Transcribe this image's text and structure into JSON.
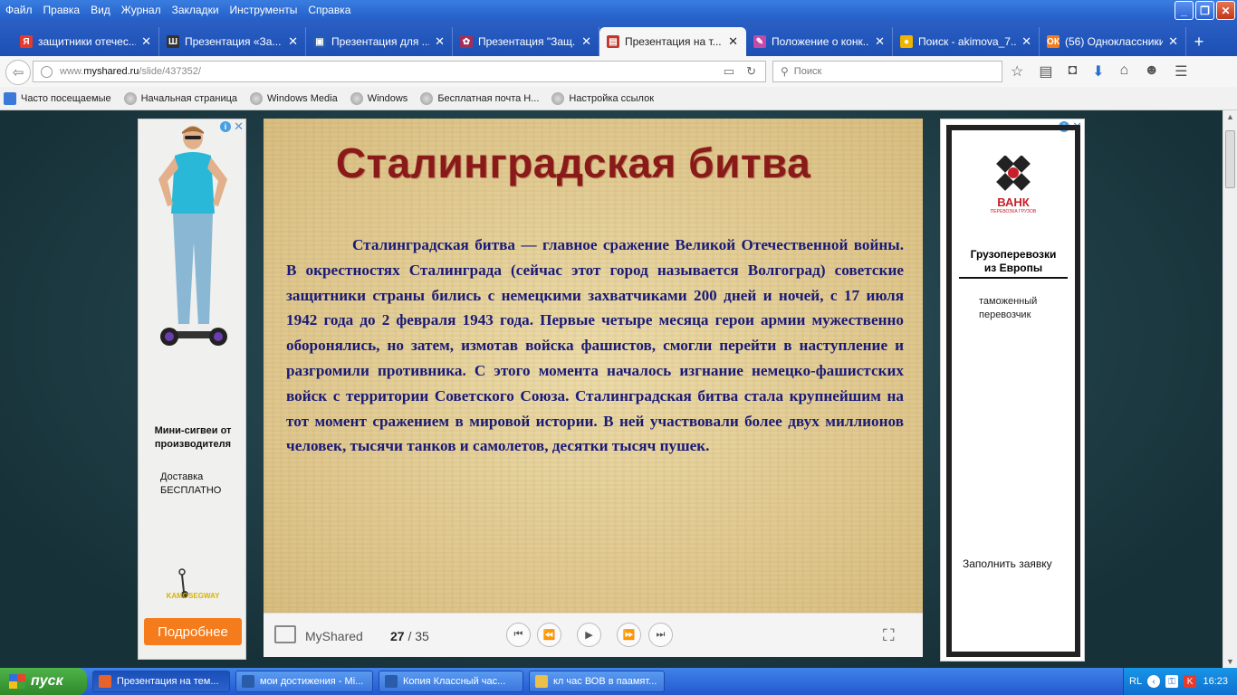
{
  "menu": [
    "Файл",
    "Правка",
    "Вид",
    "Журнал",
    "Закладки",
    "Инструменты",
    "Справка"
  ],
  "window_controls": {
    "minimize": "_",
    "maximize": "❐",
    "close": "✕"
  },
  "tabs": [
    {
      "label": "защитники отечес...",
      "icon_color": "#e53a2c",
      "icon_char": "Я",
      "active": false
    },
    {
      "label": "Презентация «За...",
      "icon_color": "#333333",
      "icon_char": "Ш",
      "active": false
    },
    {
      "label": "Презентация для ...",
      "icon_color": "#2a5caa",
      "icon_char": "▣",
      "active": false
    },
    {
      "label": "Презентация \"Защ...",
      "icon_color": "#a0305a",
      "icon_char": "✿",
      "active": false
    },
    {
      "label": "Презентация на т...",
      "icon_color": "#c0392b",
      "icon_char": "▤",
      "active": true
    },
    {
      "label": "Положение о конк...",
      "icon_color": "#c24aa8",
      "icon_char": "✎",
      "active": false
    },
    {
      "label": "Поиск - akimova_7...",
      "icon_color": "#f0b400",
      "icon_char": "●",
      "active": false
    },
    {
      "label": "(56) Одноклассники",
      "icon_color": "#f57c1c",
      "icon_char": "ОК",
      "active": false
    }
  ],
  "new_tab": "+",
  "url": {
    "prefix": "www.",
    "domain": "myshared.ru",
    "path": "/slide/437352/"
  },
  "search": {
    "placeholder": "Поиск"
  },
  "bookmarks": [
    "Часто посещаемые",
    "Начальная страница",
    "Windows Media",
    "Windows",
    "Бесплатная почта Н...",
    "Настройка ссылок"
  ],
  "left_ad": {
    "title": "Мини-сигвеи от производителя",
    "line1": "Доставка",
    "line2": "БЕСПЛАТНО",
    "logo_text": "KAMOSEGWAY",
    "button": "Подробнее",
    "info": "i",
    "close": "✕"
  },
  "slide": {
    "title": "Сталинградская битва",
    "body": "Сталинградская битва — главное сражение Великой Отечественной войны. В окрестностях Сталинграда (сейчас этот город называется Волгоград) советские защитники страны бились с немецкими захватчиками 200 дней и ночей, с 17 июля 1942 года до 2 февраля 1943 года. Первые четыре месяца герои армии мужественно оборонялись, но затем, измотав войска фашистов, смогли перейти в наступление и разгромили противника. С этого момента началось изгнание немецко-фашистских войск с территории Советского Союза. Сталинградская битва стала крупнейшим на тот момент сражением в мировой истории. В ней участвовали более двух миллионов человек, тысячи танков и самолетов, десятки тысяч пушек."
  },
  "player": {
    "brand": "MyShared",
    "current": "27",
    "separator": " / ",
    "total": "35",
    "controls": {
      "first": "⏮",
      "prev": "⏪",
      "play": "▶",
      "next": "⏩",
      "last": "⏭"
    },
    "fullscreen": "⛶"
  },
  "right_ad": {
    "logo": "ВАНК",
    "logo_sub": "ПЕРЕВОЗКА ГРУЗОВ",
    "heading_line1": "Грузоперевозки",
    "heading_line2": "из Европы",
    "sub_line1": "таможенный",
    "sub_line2": "перевозчик",
    "cta": "Заполнить заявку",
    "info": "i",
    "close": "✕"
  },
  "taskbar": {
    "start": "пуск",
    "items": [
      {
        "label": "Презентация на тем...",
        "icon_color": "#e8632b",
        "active": true
      },
      {
        "label": "мои достижения - Mi...",
        "icon_color": "#2a5caa",
        "active": false
      },
      {
        "label": "Копия Классный час...",
        "icon_color": "#2a5caa",
        "active": false
      },
      {
        "label": "кл час ВОВ в паамят...",
        "icon_color": "#e8c04a",
        "active": false
      }
    ],
    "lang": "RL",
    "time": "16:23"
  }
}
